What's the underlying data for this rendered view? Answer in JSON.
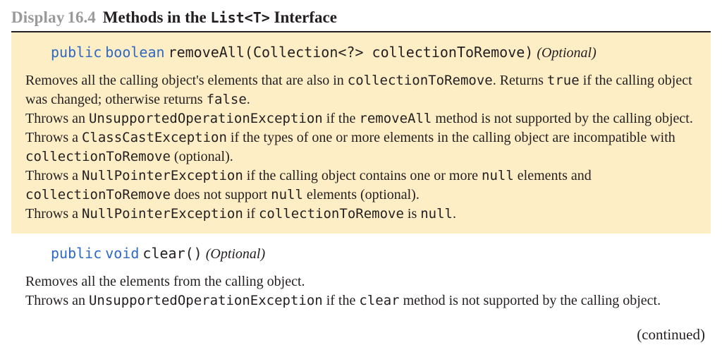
{
  "header": {
    "label": "Display",
    "number": "16.4",
    "title_pre": "Methods in the ",
    "title_code": "List<T>",
    "title_post": " Interface"
  },
  "method1": {
    "sig": {
      "kw1": "public",
      "kw2": "boolean",
      "name": "removeAll(Collection<?> collectionToRemove)",
      "optional": "(Optional)"
    },
    "p1a": "Removes all the calling object's elements that are also in ",
    "p1b": "collectionToRemove",
    "p1c": ". Returns ",
    "p1d": "true",
    "p1e": " if the calling object was changed; otherwise returns ",
    "p1f": "false",
    "p1g": ".",
    "p2a": "Throws an ",
    "p2b": "UnsupportedOperationException",
    "p2c": " if the ",
    "p2d": "removeAll",
    "p2e": " method is not supported by the calling object.",
    "p3a": "Throws a ",
    "p3b": "ClassCastException",
    "p3c": " if the types of one or more elements in the calling object are incompatible with ",
    "p3d": "collectionToRemove",
    "p3e": " (optional).",
    "p4a": "Throws a ",
    "p4b": "NullPointerException",
    "p4c": " if the calling object contains one or more ",
    "p4d": "null",
    "p4e": " elements and ",
    "p4f": "collectionToRemove",
    "p4g": " does not support ",
    "p4h": "null",
    "p4i": " elements (optional).",
    "p5a": "Throws a ",
    "p5b": "NullPointerException",
    "p5c": " if ",
    "p5d": "collectionToRemove",
    "p5e": " is ",
    "p5f": "null",
    "p5g": "."
  },
  "method2": {
    "sig": {
      "kw1": "public",
      "kw2": "void",
      "name": "clear()",
      "optional": "(Optional)"
    },
    "p1": "Removes all the elements from the calling object.",
    "p2a": "Throws an ",
    "p2b": "UnsupportedOperationException",
    "p2c": " if the ",
    "p2d": "clear",
    "p2e": " method is not supported by the calling object."
  },
  "continued": "(continued)"
}
